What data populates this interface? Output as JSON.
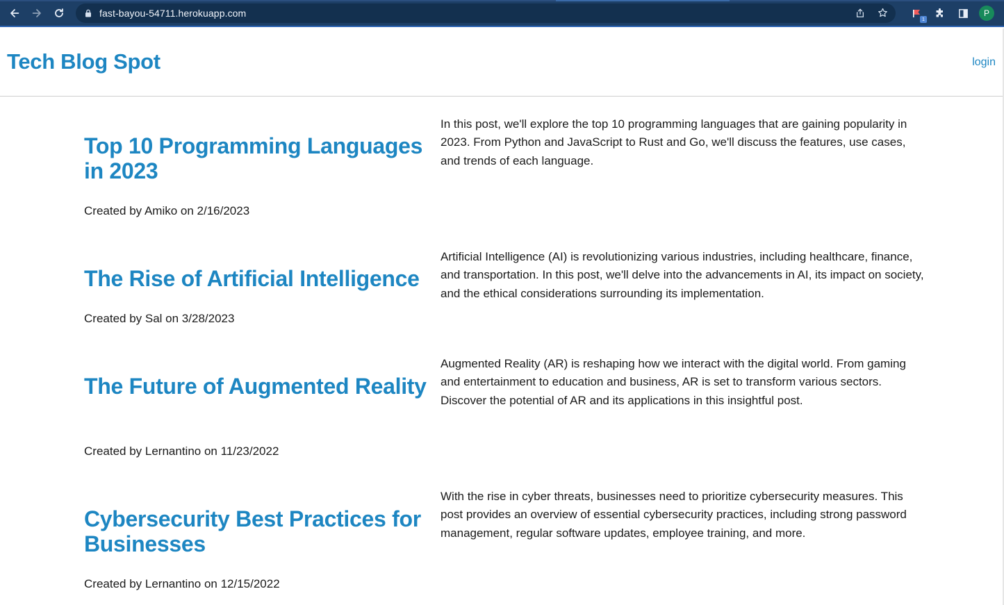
{
  "browser": {
    "url": "fast-bayou-54711.herokuapp.com",
    "profile_initial": "P",
    "extension_badge": "1",
    "icons": [
      "back-arrow-icon",
      "forward-arrow-icon",
      "reload-icon",
      "lock-icon",
      "share-icon",
      "star-icon",
      "extension-flag-icon",
      "puzzle-icon",
      "sidebar-icon"
    ]
  },
  "header": {
    "title": "Tech Blog Spot",
    "login_label": "login"
  },
  "colors": {
    "accent": "#1d86c2",
    "chrome": "#1d3f66"
  },
  "posts": [
    {
      "title": "Top 10 Programming Languages in 2023",
      "meta": "Created by Amiko on 2/16/2023",
      "body": "In this post, we'll explore the top 10 programming languages that are gaining popularity in 2023. From Python and JavaScript to Rust and Go, we'll discuss the features, use cases, and trends of each language."
    },
    {
      "title": "The Rise of Artificial Intelligence",
      "meta": "Created by Sal on 3/28/2023",
      "body": "Artificial Intelligence (AI) is revolutionizing various industries, including healthcare, finance, and transportation. In this post, we'll delve into the advancements in AI, its impact on society, and the ethical considerations surrounding its implementation."
    },
    {
      "title": "The Future of Augmented Reality",
      "meta": "Created by Lernantino on 11/23/2022",
      "body": "Augmented Reality (AR) is reshaping how we interact with the digital world. From gaming and entertainment to education and business, AR is set to transform various sectors. Discover the potential of AR and its applications in this insightful post."
    },
    {
      "title": "Cybersecurity Best Practices for Businesses",
      "meta": "Created by Lernantino on 12/15/2022",
      "body": "With the rise in cyber threats, businesses need to prioritize cybersecurity measures. This post provides an overview of essential cybersecurity practices, including strong password management, regular software updates, employee training, and more."
    }
  ]
}
